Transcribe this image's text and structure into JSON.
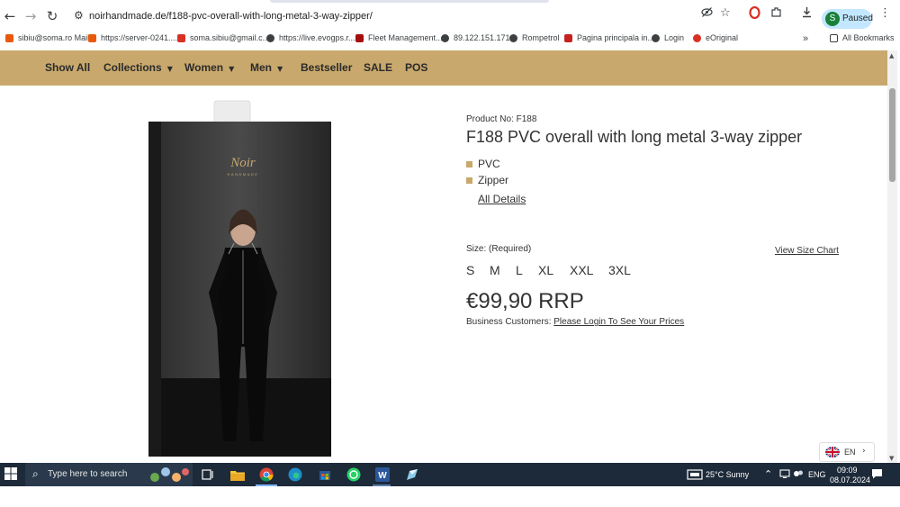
{
  "browser": {
    "url": "noirhandmade.de/f188-pvc-overall-with-long-metal-3-way-zipper/",
    "profile_status": "Paused",
    "profile_initial": "S",
    "bookmarks": [
      {
        "label": "sibiu@soma.ro Mail",
        "color": "#e8590c"
      },
      {
        "label": "https://server-0241....",
        "color": "#e8590c"
      },
      {
        "label": "soma.sibiu@gmail.c...",
        "color": "#d93025"
      },
      {
        "label": "https://live.evogps.r...",
        "color": "#3c4043"
      },
      {
        "label": "Fleet Management...",
        "color": "#a50e0e"
      },
      {
        "label": "89.122.151.171",
        "color": "#3c4043"
      },
      {
        "label": "Rompetrol",
        "color": "#3c4043"
      },
      {
        "label": "Pagina principala in...",
        "color": "#c5221f"
      },
      {
        "label": "Login",
        "color": "#3c4043"
      },
      {
        "label": "eOriginal",
        "color": "#d93025"
      }
    ],
    "all_bookmarks": "All Bookmarks",
    "more_bookmarks": "»"
  },
  "site_nav": {
    "items": [
      "Show All",
      "Collections",
      "Women",
      "Men",
      "Bestseller",
      "SALE",
      "POS"
    ],
    "accent": "#c8a86c"
  },
  "product": {
    "number": "Product No: F188",
    "title": "F188 PVC overall with long metal 3-way zipper",
    "features": [
      "PVC",
      "Zipper"
    ],
    "all_details": "All Details",
    "size_label": "Size:  (Required)",
    "size_chart": "View Size Chart",
    "sizes": [
      "S",
      "M",
      "L",
      "XL",
      "XXL",
      "3XL"
    ],
    "price": "€99,90 RRP",
    "business_prefix": "Business Customers: ",
    "business_link": "Please Login To See Your Prices",
    "box_brand": "Noir",
    "box_sub": "HANDMADE"
  },
  "language": {
    "code": "EN"
  },
  "taskbar": {
    "search_placeholder": "Type here to search",
    "weather": "25°C  Sunny",
    "lang": "ENG",
    "time": "09:09",
    "date": "08.07.2024"
  }
}
